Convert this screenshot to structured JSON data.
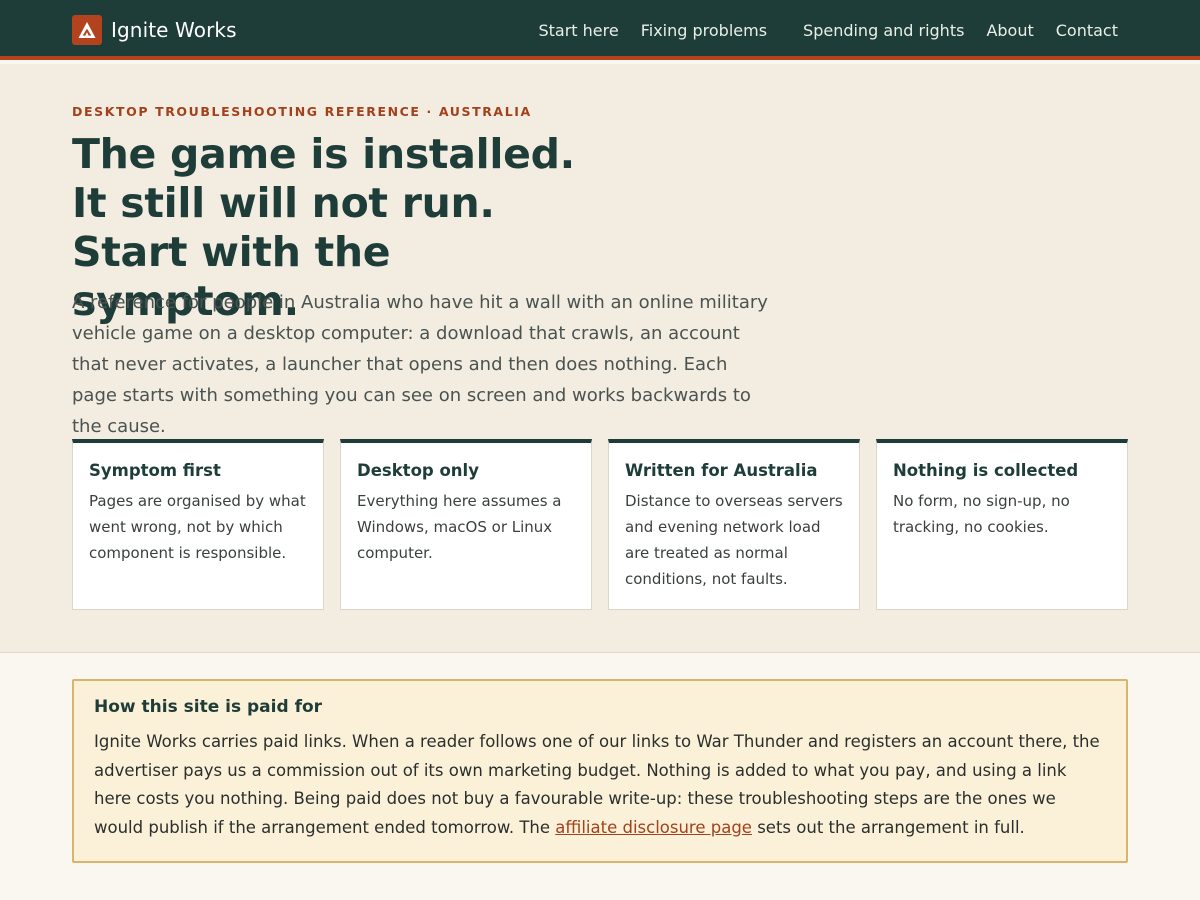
{
  "brand": {
    "name": "Ignite Works",
    "logo_icon": "flame-triangle-icon",
    "logo_color": "#b2431e"
  },
  "nav": {
    "items": [
      "Start here",
      "Fixing problems",
      "Spending and rights",
      "About",
      "Contact"
    ]
  },
  "hero": {
    "eyebrow": "DESKTOP TROUBLESHOOTING REFERENCE · AUSTRALIA",
    "headline": "The game is installed. It still will not run. Start with the symptom.",
    "lede": "A reference for people in Australia who have hit a wall with an online military vehicle game on a desktop computer: a download that crawls, an account that never activates, a launcher that opens and then does nothing. Each page starts with something you can see on screen and works backwards to the cause."
  },
  "cards": [
    {
      "title": "Symptom first",
      "body": "Pages are organised by what went wrong, not by which component is responsible."
    },
    {
      "title": "Desktop only",
      "body": "Everything here assumes a Windows, macOS or Linux computer."
    },
    {
      "title": "Written for Australia",
      "body": "Distance to overseas servers and evening network load are treated as normal conditions, not faults."
    },
    {
      "title": "Nothing is collected",
      "body": "No form, no sign-up, no tracking, no cookies."
    }
  ],
  "notice": {
    "title": "How this site is paid for",
    "body_before": "Ignite Works carries paid links. When a reader follows one of our links to War Thunder and registers an account there, the advertiser pays us a commission out of its own marketing budget. Nothing is added to what you pay, and using a link here costs you nothing. Being paid does not buy a favourable write-up: these troubleshooting steps are the ones we would publish if the arrangement ended tomorrow. The ",
    "link_text": "affiliate disclosure page",
    "body_after": " sets out the arrangement in full."
  },
  "colors": {
    "header_bg": "#1e3d38",
    "accent": "#b2431e",
    "hero_bg": "#f2ece1",
    "notice_bg": "#fbf0d8",
    "notice_border": "#d9b46d"
  }
}
